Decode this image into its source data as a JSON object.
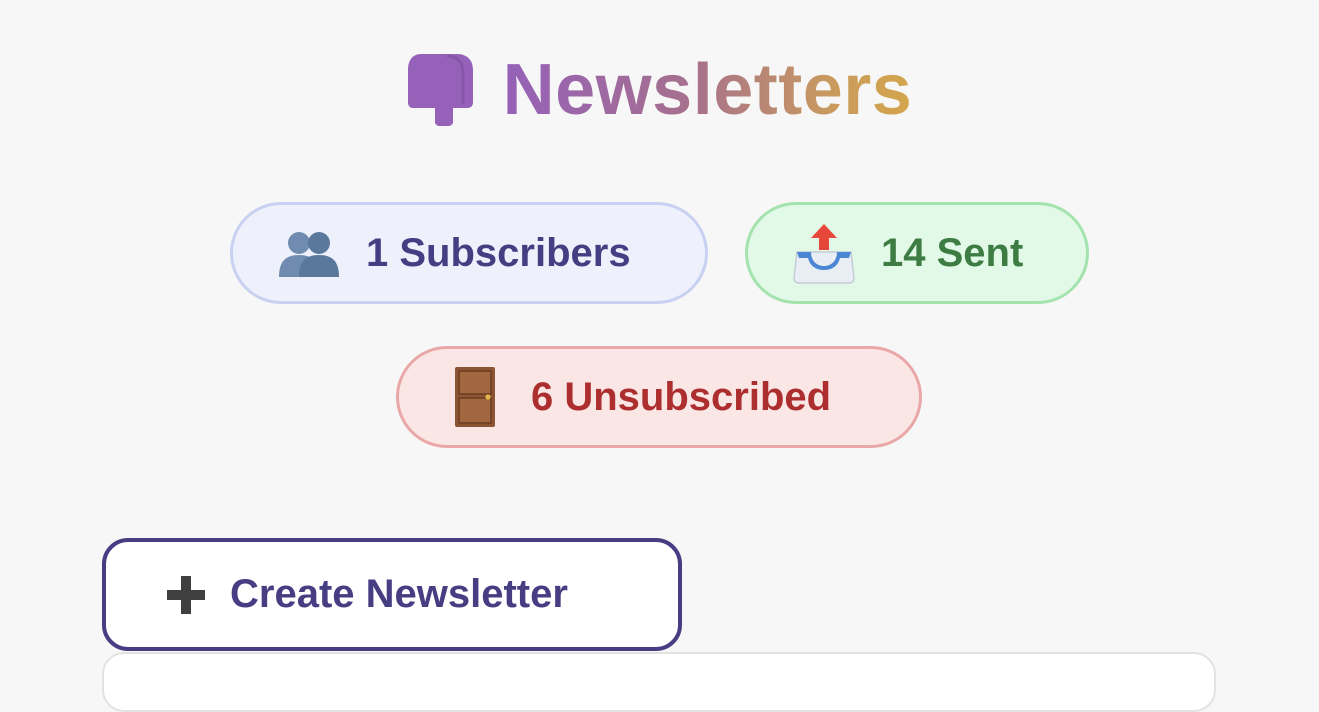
{
  "header": {
    "icon": "mailbox-icon",
    "title": "Newsletters",
    "gradient": [
      "#9561b9",
      "#a6708e",
      "#c99a5e",
      "#d4a64c"
    ]
  },
  "stats": {
    "subscribers": {
      "icon": "people-icon",
      "label": "1 Subscribers",
      "color": "#463d82",
      "background": "#eef1fc"
    },
    "sent": {
      "icon": "outbox-tray-icon",
      "label": "14 Sent",
      "color": "#3d7d43",
      "background": "#e3f9e7"
    },
    "unsubscribed": {
      "icon": "door-icon",
      "label": "6 Unsubscribed",
      "color": "#ad2e2e",
      "background": "#fbe6e6"
    }
  },
  "actions": {
    "create": {
      "icon": "plus-icon",
      "label": "Create Newsletter",
      "color": "#463d82"
    }
  }
}
